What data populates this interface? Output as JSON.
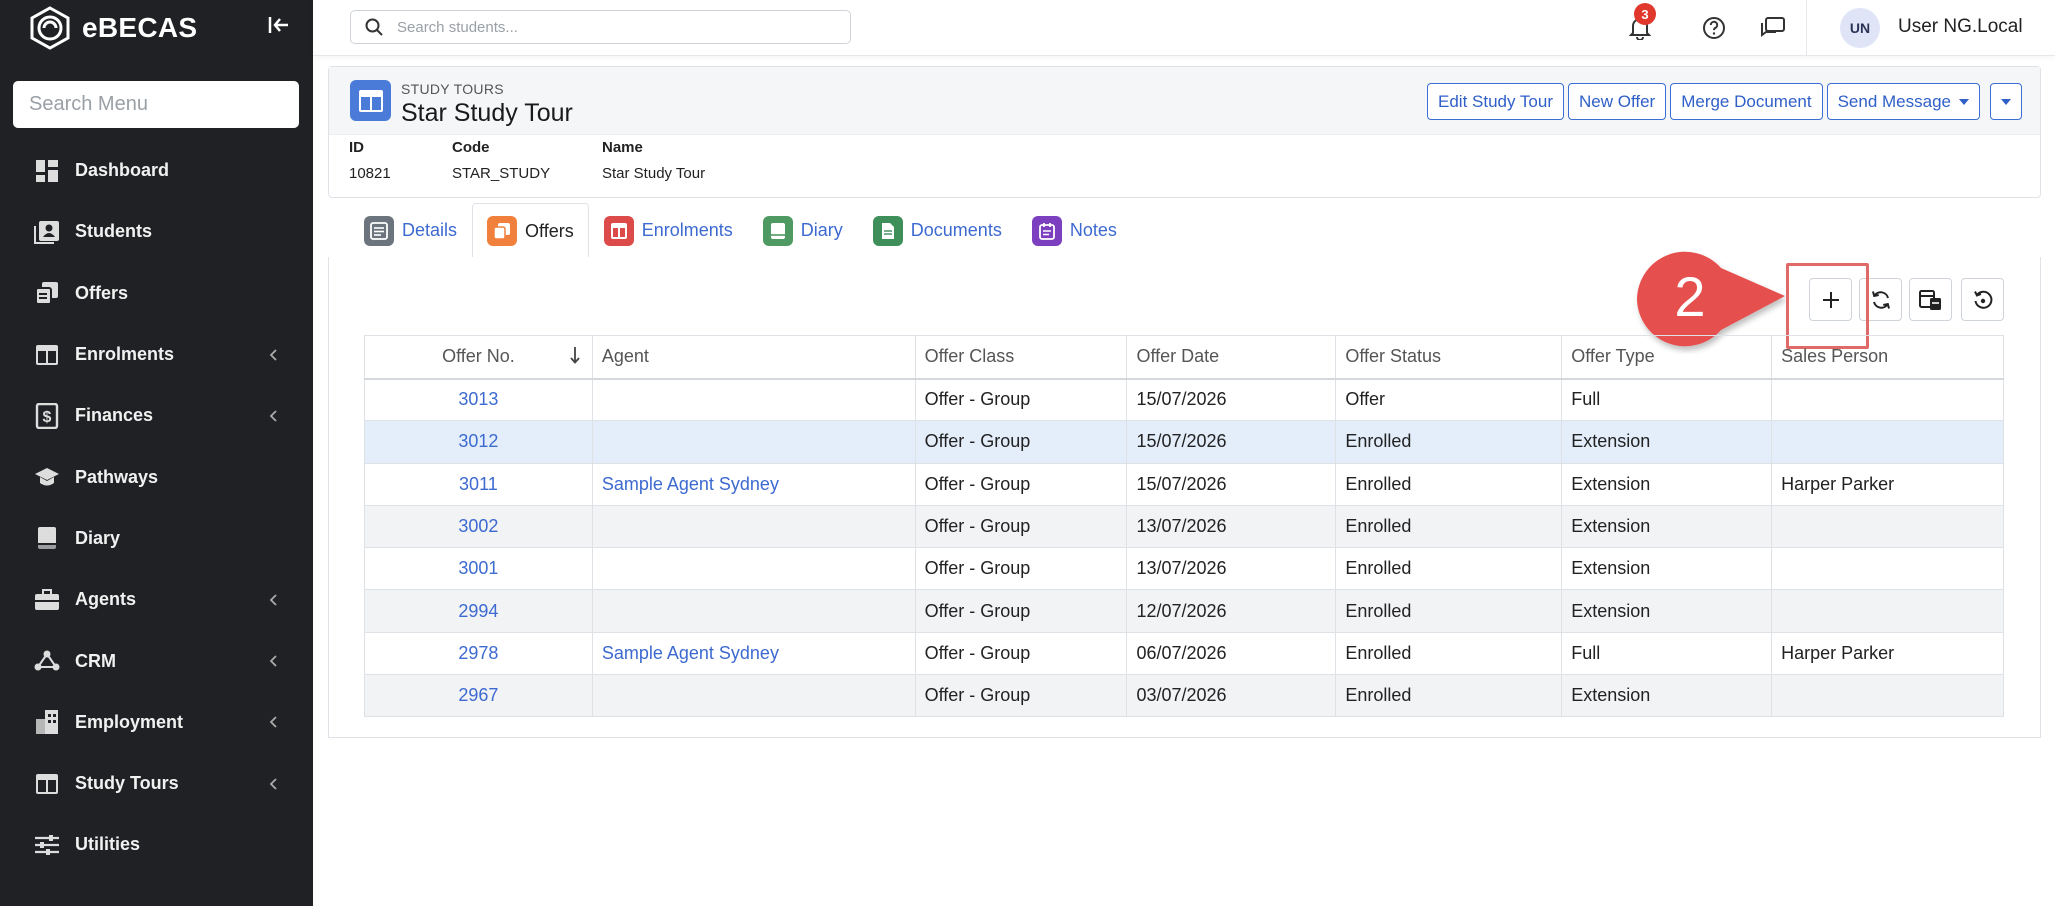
{
  "app": {
    "name": "eBECAS"
  },
  "sidebar": {
    "search_placeholder": "Search Menu",
    "items": [
      {
        "label": "Dashboard",
        "icon": "dashboard-icon",
        "has_submenu": false
      },
      {
        "label": "Students",
        "icon": "students-icon",
        "has_submenu": false
      },
      {
        "label": "Offers",
        "icon": "offers-icon",
        "has_submenu": false
      },
      {
        "label": "Enrolments",
        "icon": "enrolments-icon",
        "has_submenu": true
      },
      {
        "label": "Finances",
        "icon": "finances-icon",
        "has_submenu": true
      },
      {
        "label": "Pathways",
        "icon": "pathways-icon",
        "has_submenu": false
      },
      {
        "label": "Diary",
        "icon": "diary-icon",
        "has_submenu": false
      },
      {
        "label": "Agents",
        "icon": "agents-icon",
        "has_submenu": true
      },
      {
        "label": "CRM",
        "icon": "crm-icon",
        "has_submenu": true
      },
      {
        "label": "Employment",
        "icon": "employment-icon",
        "has_submenu": true
      },
      {
        "label": "Study Tours",
        "icon": "study-tours-icon",
        "has_submenu": true
      },
      {
        "label": "Utilities",
        "icon": "utilities-icon",
        "has_submenu": false
      }
    ]
  },
  "topbar": {
    "search_placeholder": "Search students...",
    "notification_count": "3",
    "user_initials": "UN",
    "user_name": "User NG.Local"
  },
  "header": {
    "breadcrumb": "STUDY TOURS",
    "title": "Star Study Tour",
    "buttons": {
      "edit": "Edit Study Tour",
      "new_offer": "New Offer",
      "merge": "Merge Document",
      "send_message": "Send Message"
    },
    "fields": {
      "id_label": "ID",
      "id_value": "10821",
      "code_label": "Code",
      "code_value": "STAR_STUDY",
      "name_label": "Name",
      "name_value": "Star Study Tour"
    }
  },
  "tabs": [
    {
      "label": "Details",
      "color": "#6c757d"
    },
    {
      "label": "Offers",
      "color": "#f0803c"
    },
    {
      "label": "Enrolments",
      "color": "#dc4a4a"
    },
    {
      "label": "Diary",
      "color": "#4f9a62"
    },
    {
      "label": "Documents",
      "color": "#3f8f5a"
    },
    {
      "label": "Notes",
      "color": "#7b3fbf"
    }
  ],
  "annotation": {
    "step": "2"
  },
  "table": {
    "columns": [
      "Offer No.",
      "Agent",
      "Offer Class",
      "Offer Date",
      "Offer Status",
      "Offer Type",
      "Sales Person"
    ],
    "rows": [
      {
        "no": "3013",
        "agent": "",
        "class": "Offer - Group",
        "date": "15/07/2026",
        "status": "Offer",
        "type": "Full",
        "sales": ""
      },
      {
        "no": "3012",
        "agent": "",
        "class": "Offer - Group",
        "date": "15/07/2026",
        "status": "Enrolled",
        "type": "Extension",
        "sales": ""
      },
      {
        "no": "3011",
        "agent": "Sample Agent Sydney",
        "class": "Offer - Group",
        "date": "15/07/2026",
        "status": "Enrolled",
        "type": "Extension",
        "sales": "Harper Parker"
      },
      {
        "no": "3002",
        "agent": "",
        "class": "Offer - Group",
        "date": "13/07/2026",
        "status": "Enrolled",
        "type": "Extension",
        "sales": ""
      },
      {
        "no": "3001",
        "agent": "",
        "class": "Offer - Group",
        "date": "13/07/2026",
        "status": "Enrolled",
        "type": "Extension",
        "sales": ""
      },
      {
        "no": "2994",
        "agent": "",
        "class": "Offer - Group",
        "date": "12/07/2026",
        "status": "Enrolled",
        "type": "Extension",
        "sales": ""
      },
      {
        "no": "2978",
        "agent": "Sample Agent Sydney",
        "class": "Offer - Group",
        "date": "06/07/2026",
        "status": "Enrolled",
        "type": "Full",
        "sales": "Harper Parker"
      },
      {
        "no": "2967",
        "agent": "",
        "class": "Offer - Group",
        "date": "03/07/2026",
        "status": "Enrolled",
        "type": "Extension",
        "sales": ""
      }
    ]
  },
  "colors": {
    "sidebar_bg": "#1f2124",
    "accent": "#3d6ad0",
    "badge": "#e0382c",
    "callout": "#e5504e"
  }
}
